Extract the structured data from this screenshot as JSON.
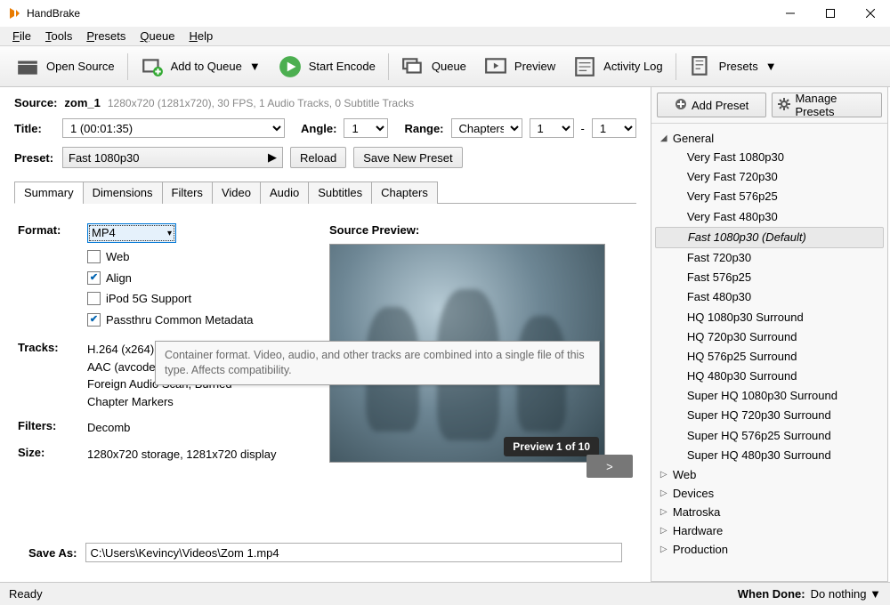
{
  "app": {
    "title": "HandBrake"
  },
  "menu": {
    "file": "File",
    "tools": "Tools",
    "presets": "Presets",
    "queue": "Queue",
    "help": "Help"
  },
  "toolbar": {
    "open_source": "Open Source",
    "add_to_queue": "Add to Queue",
    "start_encode": "Start Encode",
    "queue": "Queue",
    "preview": "Preview",
    "activity_log": "Activity Log",
    "presets": "Presets"
  },
  "source": {
    "label": "Source:",
    "name": "zom_1",
    "info": "1280x720 (1281x720), 30 FPS, 1 Audio Tracks, 0 Subtitle Tracks"
  },
  "title_row": {
    "label": "Title:",
    "value": "1 (00:01:35)",
    "angle_label": "Angle:",
    "angle": "1",
    "range_label": "Range:",
    "range_type": "Chapters",
    "range_from": "1",
    "range_sep": "-",
    "range_to": "1"
  },
  "preset_row": {
    "label": "Preset:",
    "value": "Fast 1080p30",
    "reload": "Reload",
    "save_new": "Save New Preset"
  },
  "tabs": [
    "Summary",
    "Dimensions",
    "Filters",
    "Video",
    "Audio",
    "Subtitles",
    "Chapters"
  ],
  "summary": {
    "format_label": "Format:",
    "format_value": "MP4",
    "cb_web": "Web",
    "cb_align": "Align",
    "cb_ipod": "iPod 5G Support",
    "cb_passthru": "Passthru Common Metadata",
    "tracks_label": "Tracks:",
    "tracks": [
      "H.264 (x264), 30 FPS PFR",
      "AAC (avcodec), Stereo",
      "Foreign Audio Scan, Burned",
      "Chapter Markers"
    ],
    "filters_label": "Filters:",
    "filters_value": "Decomb",
    "size_label": "Size:",
    "size_value": "1280x720 storage, 1281x720 display",
    "preview_label": "Source Preview:",
    "preview_badge": "Preview 1 of 10",
    "next": ">"
  },
  "tooltip": "Container format. Video, audio, and other tracks are combined into a single file of this type. Affects compatibility.",
  "preset_panel": {
    "add": "Add Preset",
    "manage": "Manage Presets",
    "categories": [
      {
        "name": "General",
        "expanded": true,
        "items": [
          "Very Fast 1080p30",
          "Very Fast 720p30",
          "Very Fast 576p25",
          "Very Fast 480p30",
          "Fast 1080p30",
          "Fast 720p30",
          "Fast 576p25",
          "Fast 480p30",
          "HQ 1080p30 Surround",
          "HQ 720p30 Surround",
          "HQ 576p25 Surround",
          "HQ 480p30 Surround",
          "Super HQ 1080p30 Surround",
          "Super HQ 720p30 Surround",
          "Super HQ 576p25 Surround",
          "Super HQ 480p30 Surround"
        ],
        "selected_index": 4,
        "default_suffix": "(Default)"
      },
      {
        "name": "Web",
        "expanded": false
      },
      {
        "name": "Devices",
        "expanded": false
      },
      {
        "name": "Matroska",
        "expanded": false
      },
      {
        "name": "Hardware",
        "expanded": false
      },
      {
        "name": "Production",
        "expanded": false
      }
    ]
  },
  "saveas": {
    "label": "Save As:",
    "value": "C:\\Users\\Kevincy\\Videos\\Zom 1.mp4"
  },
  "status": {
    "ready": "Ready",
    "whendone_label": "When Done:",
    "whendone_value": "Do nothing"
  }
}
